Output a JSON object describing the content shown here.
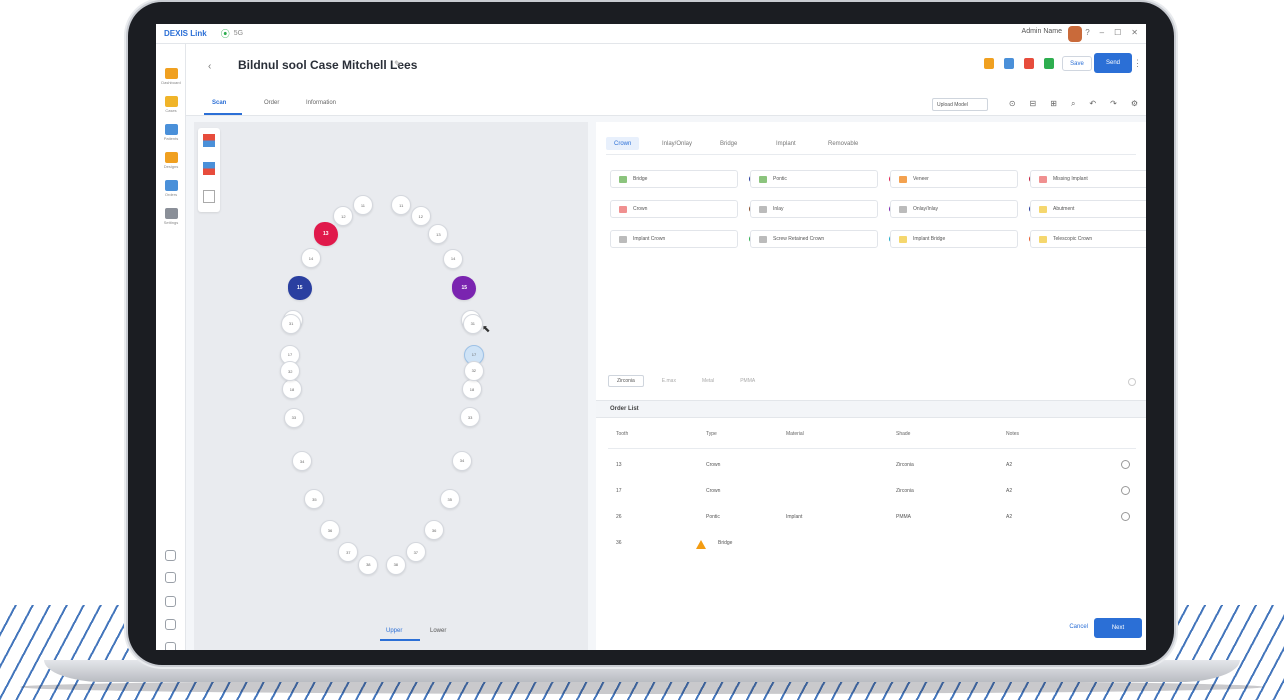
{
  "app": {
    "brand": "DEXIS Link",
    "wifi_label": "5G",
    "user_name": "Admin Name",
    "window_controls": [
      "?",
      "–",
      "☐",
      "✕"
    ]
  },
  "nav": {
    "items": [
      {
        "label": "Dashboard",
        "color": "#f0a020"
      },
      {
        "label": "Cases",
        "color": "#f0b429"
      },
      {
        "label": "Patients",
        "color": "#4a90d9"
      },
      {
        "label": "Designs",
        "color": "#f0a020"
      },
      {
        "label": "Orders",
        "color": "#4a90d9"
      },
      {
        "label": "Settings",
        "color": "#8a8f98"
      }
    ]
  },
  "header": {
    "back": "‹",
    "case_title": "Bildnul sool Case Mitchell Lees",
    "edit": "✎",
    "status_icons": [
      "#f0a020",
      "#4a90d9",
      "#e74c3c",
      "#2eae4f"
    ],
    "draft_button": "Save",
    "primary_button": "Send",
    "more": "⋮"
  },
  "subtabs": {
    "tabs": [
      "Scan",
      "Order",
      "Information"
    ],
    "tool_select": "Upload Model",
    "tools": [
      "⊙",
      "⊟",
      "⊞",
      "⌕",
      "↶",
      "↷",
      "⚙"
    ]
  },
  "canvas": {
    "view_buttons": [
      "Upper",
      "Lower"
    ]
  },
  "restoration_types": {
    "tabs": [
      "Crown",
      "Inlay/Onlay",
      "Bridge",
      "Implant",
      "Removable"
    ],
    "items": [
      {
        "label": "Bridge",
        "icon": "#8bc47d",
        "dot": "#2a3fa0"
      },
      {
        "label": "Pontic",
        "icon": "#8bc47d",
        "dot": "#e0194b"
      },
      {
        "label": "Veneer",
        "icon": "#f3a14f",
        "dot": "#c2193a"
      },
      {
        "label": "Missing Implant",
        "icon": "#f09090",
        "dot": "#f0a020"
      },
      {
        "label": "Crown",
        "icon": "#f09090",
        "dot": "#8a4f2d"
      },
      {
        "label": "Inlay",
        "icon": "#bbbbbb",
        "dot": "#7a24b0"
      },
      {
        "label": "Onlay/Inlay",
        "icon": "#bbbbbb",
        "dot": "#2a3fa0"
      },
      {
        "label": "Abutment",
        "icon": "#f5d76e",
        "dot": "#c2193a"
      },
      {
        "label": "Implant Crown",
        "icon": "#bbbbbb",
        "dot": "#2eae4f"
      },
      {
        "label": "Screw Retained Crown",
        "icon": "#bbbbbb",
        "dot": "#1aa9c9"
      },
      {
        "label": "Implant Bridge",
        "icon": "#f5d76e",
        "dot": "#e85a2b"
      },
      {
        "label": "Telescopic Crown",
        "icon": "#f5d76e",
        "dot": "#7a4cb0"
      }
    ]
  },
  "materials": {
    "options": [
      "Zirconia",
      "E.max",
      "Metal",
      "PMMA"
    ]
  },
  "order": {
    "title": "Order List",
    "columns": [
      "Tooth",
      "Type",
      "Material",
      "Shade",
      "Notes"
    ],
    "rows": [
      {
        "tooth": "13",
        "type": "Crown",
        "material": "",
        "shade": "Zirconia",
        "notes": "A2"
      },
      {
        "tooth": "17",
        "type": "Crown",
        "material": "",
        "shade": "Zirconia",
        "notes": "A2"
      },
      {
        "tooth": "26",
        "type": "Pontic",
        "material": "Implant",
        "shade": "PMMA",
        "notes": "A2"
      },
      {
        "tooth": "36",
        "type": "Bridge",
        "material": "",
        "shade": "",
        "notes": ""
      }
    ]
  },
  "footer": {
    "cancel": "Cancel",
    "next": "Next"
  },
  "teeth": {
    "upper": [
      {
        "n": "11",
        "mark": null
      },
      {
        "n": "12",
        "mark": null
      },
      {
        "n": "13",
        "mark": "#e0194b"
      },
      {
        "n": "14",
        "mark": null
      },
      {
        "n": "15",
        "mark": "#2a3fa0"
      },
      {
        "n": "16",
        "mark": null
      },
      {
        "n": "17",
        "mark": null
      },
      {
        "n": "18",
        "mark": null
      },
      {
        "n": "21",
        "mark": null
      },
      {
        "n": "22",
        "mark": null
      },
      {
        "n": "23",
        "mark": null
      },
      {
        "n": "24",
        "mark": null
      },
      {
        "n": "25",
        "mark": "#7a24b0"
      },
      {
        "n": "26",
        "mark": null
      },
      {
        "n": "27",
        "mark": "selected"
      },
      {
        "n": "28",
        "mark": null
      }
    ],
    "lower": [
      {
        "n": "31"
      },
      {
        "n": "32"
      },
      {
        "n": "33"
      },
      {
        "n": "34"
      },
      {
        "n": "35"
      },
      {
        "n": "36"
      },
      {
        "n": "37"
      },
      {
        "n": "38"
      },
      {
        "n": "41"
      },
      {
        "n": "42"
      },
      {
        "n": "43"
      },
      {
        "n": "44"
      },
      {
        "n": "45"
      },
      {
        "n": "46"
      },
      {
        "n": "47"
      },
      {
        "n": "48"
      }
    ]
  }
}
